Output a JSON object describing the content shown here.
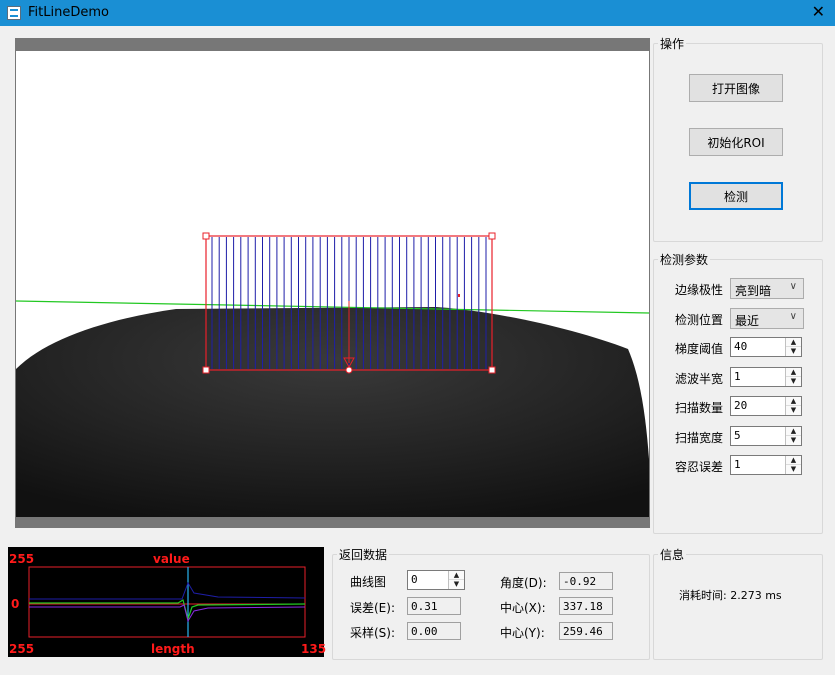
{
  "window": {
    "title": "FitLineDemo",
    "close_glyph": "✕",
    "icon": "app-icon"
  },
  "operations": {
    "legend": "操作",
    "open_image": "打开图像",
    "init_roi": "初始化ROI",
    "detect": "检测"
  },
  "params": {
    "legend": "检测参数",
    "edge_polarity": {
      "label": "边缘极性",
      "value": "亮到暗"
    },
    "detect_position": {
      "label": "检测位置",
      "value": "最近"
    },
    "gradient_threshold": {
      "label": "梯度阈值",
      "value": "40"
    },
    "filter_half_width": {
      "label": "滤波半宽",
      "value": "1"
    },
    "scan_count": {
      "label": "扫描数量",
      "value": "20"
    },
    "scan_width": {
      "label": "扫描宽度",
      "value": "5"
    },
    "tolerance": {
      "label": "容忍误差",
      "value": "1"
    }
  },
  "results": {
    "legend": "返回数据",
    "curve_label": "曲线图",
    "curve_value": "0",
    "error_label": "误差(E):",
    "error_value": "0.31",
    "sample_label": "采样(S):",
    "sample_value": "0.00",
    "angle_label": "角度(D):",
    "angle_value": "-0.92",
    "center_x_label": "中心(X):",
    "center_x_value": "337.18",
    "center_y_label": "中心(Y):",
    "center_y_value": "259.46"
  },
  "info": {
    "legend": "信息",
    "elapsed": "消耗时间: 2.273 ms"
  },
  "plot": {
    "top_left": "255",
    "top_center": "value",
    "mid_left": "0",
    "bottom_left": "255",
    "bottom_center": "length",
    "bottom_right": "135"
  },
  "colors": {
    "titlebar": "#1a8fd4",
    "roi": "#e8202a",
    "scan_lines": "#1e1ea8",
    "fit_line": "#22c822",
    "plot_label": "#ff1a1a",
    "focus": "#0078d7"
  }
}
